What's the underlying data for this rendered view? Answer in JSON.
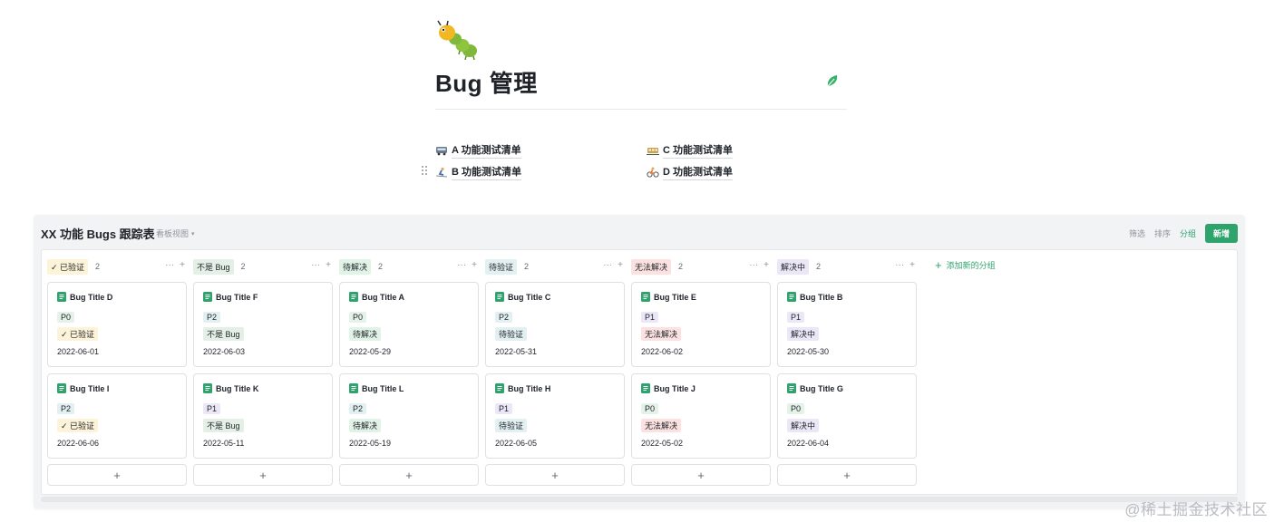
{
  "page": {
    "title": "Bug 管理",
    "icon": "caterpillar-icon",
    "leaf_icon": "leaf-icon"
  },
  "links": [
    {
      "emoji": "bus-icon",
      "label": "A 功能测试清单"
    },
    {
      "emoji": "skier-icon",
      "label": "B 功能测试清单"
    },
    {
      "emoji": "train-icon",
      "label": "C 功能测试清单"
    },
    {
      "emoji": "cyclist-icon",
      "label": "D 功能测试清单"
    }
  ],
  "board": {
    "title": "XX 功能 Bugs 跟踪表",
    "view_label": "看板视图",
    "toolbar": {
      "filter": "筛选",
      "sort": "排序",
      "group": "分组",
      "new": "新增"
    },
    "add_group": "添加新的分组",
    "columns": [
      {
        "label": "✓ 已验证",
        "count": "2",
        "tag_color": "#fdf3d8",
        "cards": [
          {
            "title": "Bug Title D",
            "priority": "P0",
            "status": "✓ 已验证",
            "date": "2022-06-01"
          },
          {
            "title": "Bug Title I",
            "priority": "P2",
            "status": "✓ 已验证",
            "date": "2022-06-06"
          }
        ]
      },
      {
        "label": "不是 Bug",
        "count": "2",
        "tag_color": "#e4efe6",
        "cards": [
          {
            "title": "Bug Title F",
            "priority": "P2",
            "status": "不是 Bug",
            "date": "2022-06-03"
          },
          {
            "title": "Bug Title K",
            "priority": "P1",
            "status": "不是 Bug",
            "date": "2022-05-11"
          }
        ]
      },
      {
        "label": "待解决",
        "count": "2",
        "tag_color": "#e1f2e6",
        "cards": [
          {
            "title": "Bug Title A",
            "priority": "P0",
            "status": "待解决",
            "date": "2022-05-29"
          },
          {
            "title": "Bug Title L",
            "priority": "P2",
            "status": "待解决",
            "date": "2022-05-19"
          }
        ]
      },
      {
        "label": "待验证",
        "count": "2",
        "tag_color": "#e2f0f2",
        "cards": [
          {
            "title": "Bug Title C",
            "priority": "P2",
            "status": "待验证",
            "date": "2022-05-31"
          },
          {
            "title": "Bug Title H",
            "priority": "P1",
            "status": "待验证",
            "date": "2022-06-05"
          }
        ]
      },
      {
        "label": "无法解决",
        "count": "2",
        "tag_color": "#fbe2e0",
        "cards": [
          {
            "title": "Bug Title E",
            "priority": "P1",
            "status": "无法解决",
            "date": "2022-06-02"
          },
          {
            "title": "Bug Title J",
            "priority": "P0",
            "status": "无法解决",
            "date": "2022-05-02"
          }
        ]
      },
      {
        "label": "解决中",
        "count": "2",
        "tag_color": "#ebe7f7",
        "cards": [
          {
            "title": "Bug Title B",
            "priority": "P1",
            "status": "解决中",
            "date": "2022-05-30"
          },
          {
            "title": "Bug Title G",
            "priority": "P0",
            "status": "解决中",
            "date": "2022-06-04"
          }
        ]
      }
    ],
    "priority_colors": {
      "P0": "#e4f2e8",
      "P1": "#ebe7f7",
      "P2": "#e2f0f2"
    }
  },
  "watermark": "@稀土掘金技术社区",
  "colors": {
    "accent": "#2ea36b"
  }
}
